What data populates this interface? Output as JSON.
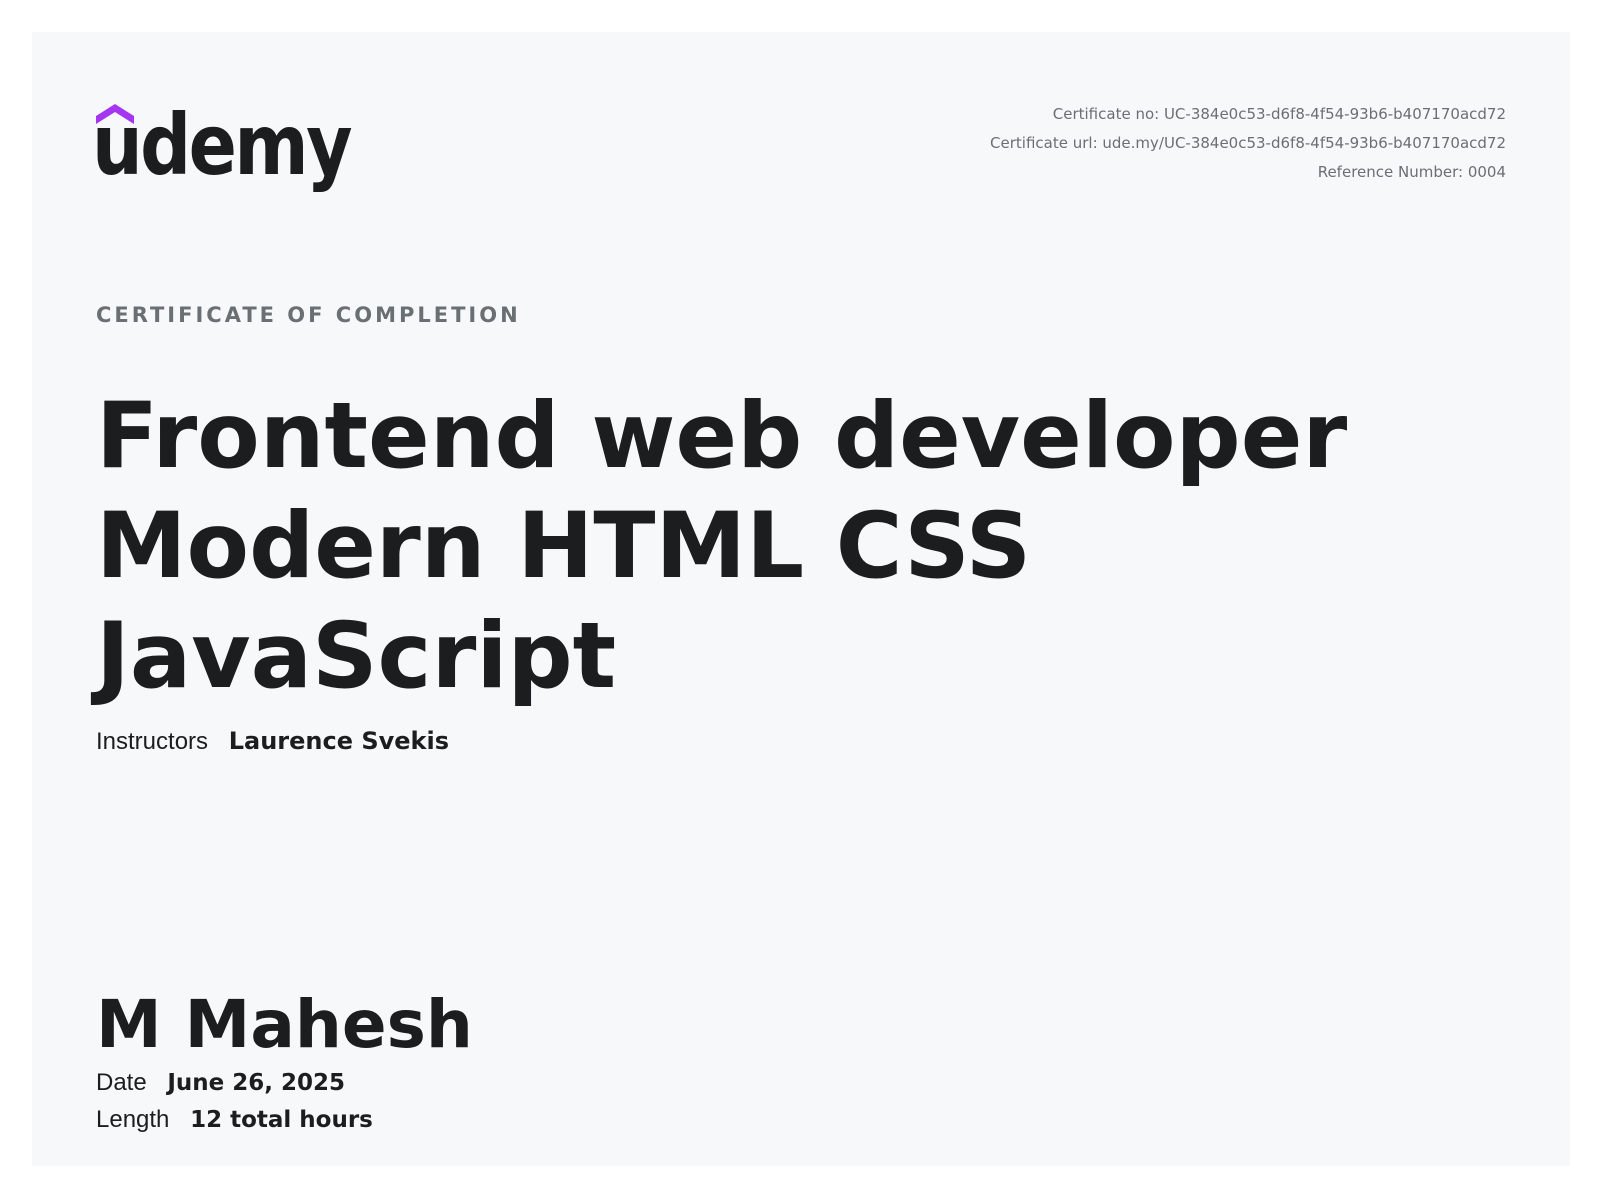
{
  "brand": {
    "name": "udemy",
    "accent_color": "#a435f0",
    "text_color": "#1c1d1f"
  },
  "meta": {
    "certificate_no": "Certificate no: UC-384e0c53-d6f8-4f54-93b6-b407170acd72",
    "certificate_url": "Certificate url: ude.my/UC-384e0c53-d6f8-4f54-93b6-b407170acd72",
    "reference_number": "Reference Number: 0004"
  },
  "certificate": {
    "overline": "CERTIFICATE OF COMPLETION",
    "title": "Frontend web developer Modern HTML CSS JavaScript",
    "instructors_label": "Instructors",
    "instructors_value": "Laurence Svekis",
    "recipient": "M Mahesh",
    "date_label": "Date",
    "date_value": "June 26, 2025",
    "length_label": "Length",
    "length_value": "12 total hours"
  }
}
